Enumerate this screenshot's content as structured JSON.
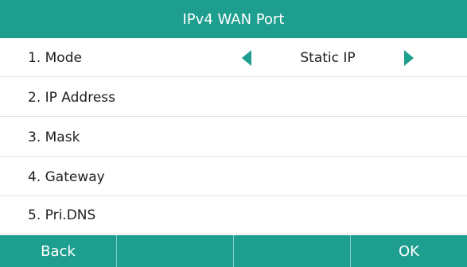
{
  "header": {
    "title": "IPv4 WAN Port"
  },
  "menu": {
    "items": [
      {
        "label": "1. Mode",
        "value": "Static IP"
      },
      {
        "label": "2. IP Address"
      },
      {
        "label": "3. Mask"
      },
      {
        "label": "4. Gateway"
      },
      {
        "label": "5. Pri.DNS"
      }
    ]
  },
  "softkeys": [
    "Back",
    "",
    "",
    "OK"
  ],
  "colors": {
    "accent": "#1e9e8f",
    "text": "#1e1e1e",
    "divider": "#e3e3e3"
  },
  "icons": {
    "left": "triangle-left-icon",
    "right": "triangle-right-icon"
  }
}
